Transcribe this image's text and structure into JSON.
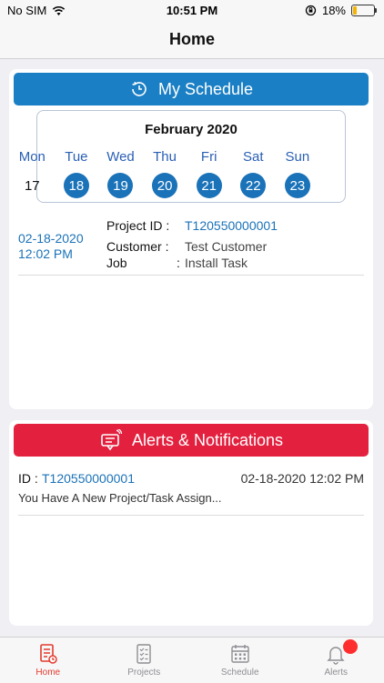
{
  "status_bar": {
    "carrier": "No SIM",
    "time": "10:51 PM",
    "battery": "18%",
    "battery_level": 0.18
  },
  "nav": {
    "title": "Home"
  },
  "schedule": {
    "header": "My Schedule",
    "month_label": "February  2020",
    "days": [
      "Mon",
      "Tue",
      "Wed",
      "Thu",
      "Fri",
      "Sat",
      "Sun"
    ],
    "dates": [
      "17",
      "18",
      "19",
      "20",
      "21",
      "22",
      "23"
    ],
    "appointment": {
      "date": "02-18-2020",
      "time": "12:02 PM",
      "project_label": "Project ID :",
      "project_id": "T120550000001",
      "customer_label": "Customer :",
      "customer": "Test Customer",
      "job_label": "Job",
      "colon": ":",
      "job": "Install Task"
    }
  },
  "alerts": {
    "header": "Alerts & Notifications",
    "item": {
      "id_label": "ID :",
      "id": "T120550000001",
      "datetime": "02-18-2020 12:02 PM",
      "message": "You Have A New Project/Task Assign..."
    }
  },
  "tabs": [
    {
      "label": "Home",
      "icon": "home-icon",
      "active": true
    },
    {
      "label": "Projects",
      "icon": "projects-icon"
    },
    {
      "label": "Schedule",
      "icon": "schedule-icon"
    },
    {
      "label": "Alerts",
      "icon": "bell-icon"
    }
  ],
  "colors": {
    "accent_blue": "#1a7fc4",
    "alert_red": "#e3213f",
    "active_tab": "#e23b2e"
  }
}
